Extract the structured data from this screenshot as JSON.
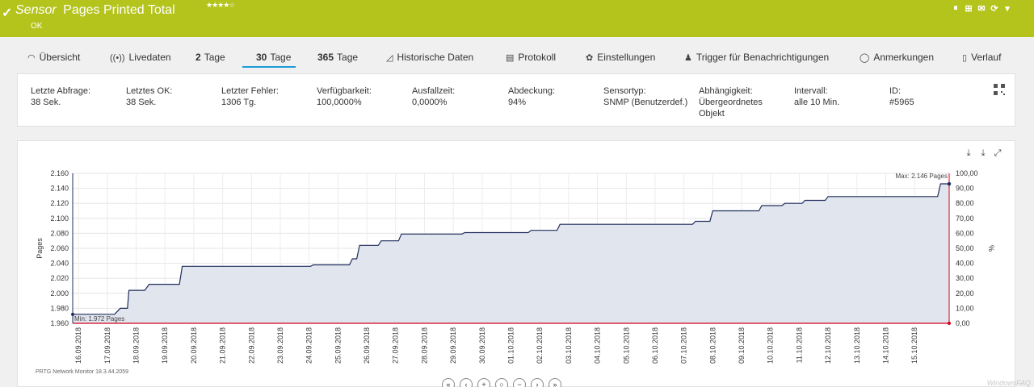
{
  "header": {
    "sensor_kind": "Sensor",
    "title": "Pages Printed Total",
    "stars": "★★★★☆",
    "status": "OK",
    "icons": [
      "pause-icon",
      "add-file-icon",
      "mail-icon",
      "refresh-icon",
      "dropdown-icon"
    ]
  },
  "tabs": [
    {
      "label": "Übersicht",
      "icon": "gauge-icon"
    },
    {
      "label": "Livedaten",
      "icon": "broadcast-icon"
    },
    {
      "num": "2",
      "label": "Tage"
    },
    {
      "num": "30",
      "label": "Tage",
      "active": true
    },
    {
      "num": "365",
      "label": "Tage"
    },
    {
      "label": "Historische Daten",
      "icon": "area-chart-icon"
    },
    {
      "label": "Protokoll",
      "icon": "list-icon"
    },
    {
      "label": "Einstellungen",
      "icon": "gear-icon"
    },
    {
      "label": "Trigger für Benachrichtigungen",
      "icon": "bell-icon"
    },
    {
      "label": "Anmerkungen",
      "icon": "comment-icon"
    },
    {
      "label": "Verlauf",
      "icon": "history-icon"
    }
  ],
  "info": [
    {
      "label": "Letzte Abfrage:",
      "value": "38 Sek."
    },
    {
      "label": "Letztes OK:",
      "value": "38 Sek."
    },
    {
      "label": "Letzter Fehler:",
      "value": "1306 Tg."
    },
    {
      "label": "Verfügbarkeit:",
      "value": "100,0000%"
    },
    {
      "label": "Ausfallzeit:",
      "value": "0,0000%"
    },
    {
      "label": "Abdeckung:",
      "value": "94%"
    },
    {
      "label": "Sensortyp:",
      "value": "SNMP (Benutzerdef.)"
    },
    {
      "label": "Abhängigkeit:",
      "value": "Übergeordnetes",
      "value2": "Objekt"
    },
    {
      "label": "Intervall:",
      "value": "alle 10 Min."
    },
    {
      "label": "ID:",
      "value": "#5965"
    }
  ],
  "chart_data": {
    "type": "area",
    "ylabel": "Pages",
    "y2label": "%",
    "ylim": [
      1960,
      2160
    ],
    "y2lim": [
      0,
      100
    ],
    "yticks": [
      "2.160",
      "2.140",
      "2.120",
      "2.100",
      "2.080",
      "2.060",
      "2.040",
      "2.020",
      "2.000",
      "1.980",
      "1.960"
    ],
    "y2ticks": [
      "100,00",
      "90,00",
      "80,00",
      "70,00",
      "60,00",
      "50,00",
      "40,00",
      "30,00",
      "20,00",
      "10,00",
      "0,00"
    ],
    "xticks": [
      "16.09.2018",
      "17.09.2018",
      "18.09.2018",
      "19.09.2018",
      "20.09.2018",
      "21.09.2018",
      "22.09.2018",
      "23.09.2018",
      "24.09.2018",
      "25.09.2018",
      "26.09.2018",
      "27.09.2018",
      "28.09.2018",
      "29.09.2018",
      "30.09.2018",
      "01.10.2018",
      "02.10.2018",
      "03.10.2018",
      "04.10.2018",
      "05.10.2018",
      "06.10.2018",
      "07.10.2018",
      "08.10.2018",
      "09.10.2018",
      "10.10.2018",
      "11.10.2018",
      "12.10.2018",
      "13.10.2018",
      "14.10.2018",
      "15.10.2018"
    ],
    "xlim": [
      0,
      30.4
    ],
    "min_label": "Min: 1.972 Pages",
    "max_label": "Max: 2.146 Pages",
    "series": [
      {
        "name": "Pages",
        "x": [
          0,
          1.45,
          1.65,
          1.9,
          1.95,
          2.5,
          2.65,
          3.7,
          3.8,
          8.25,
          8.35,
          9.6,
          9.7,
          9.85,
          9.95,
          10.6,
          10.7,
          11.3,
          11.4,
          13.5,
          13.6,
          15.8,
          15.9,
          16.8,
          16.9,
          21.5,
          21.6,
          22.1,
          22.2,
          23.8,
          23.9,
          24.6,
          24.7,
          25.3,
          25.4,
          26.1,
          26.2,
          30.0,
          30.1,
          30.4
        ],
        "values": [
          1972,
          1972,
          1980,
          1980,
          2004,
          2004,
          2012,
          2012,
          2036,
          2036,
          2038,
          2038,
          2046,
          2046,
          2064,
          2064,
          2070,
          2070,
          2079,
          2079,
          2081,
          2081,
          2084,
          2084,
          2092,
          2092,
          2096,
          2096,
          2110,
          2110,
          2117,
          2117,
          2120,
          2120,
          2124,
          2124,
          2129,
          2129,
          2146,
          2146
        ]
      },
      {
        "name": "%",
        "x": [
          0,
          30.4
        ],
        "values": [
          0,
          0
        ]
      }
    ]
  },
  "chart_tools": [
    "download-icon",
    "download-data-icon",
    "expand-icon"
  ],
  "footer_note": "PRTG Network Monitor 18.3.44.2059",
  "nav": [
    "«",
    "‹",
    "+",
    "○",
    "−",
    "›",
    "»"
  ],
  "watermark": "WindowsFAQ"
}
